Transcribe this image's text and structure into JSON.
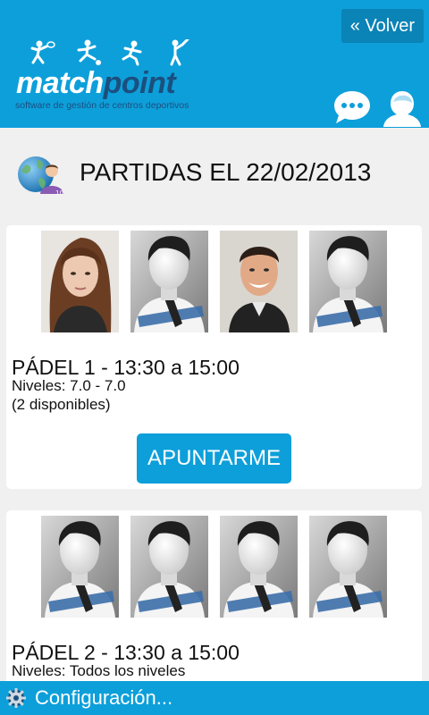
{
  "header": {
    "back_label": "« Volver",
    "logo_text_a": "match",
    "logo_text_b": "point",
    "logo_tagline": "software de gestión de centros deportivos",
    "icons": [
      "tennis-player-icon",
      "soccer-player-icon",
      "runner-icon",
      "golfer-icon",
      "chat-bubble-icon",
      "user-profile-icon"
    ]
  },
  "page": {
    "title": "PARTIDAS EL 22/02/2013",
    "title_icon": "globe-user-icon"
  },
  "matches": [
    {
      "title": "PÁDEL 1 - 13:30 a 15:00",
      "levels": "Niveles: 7.0 - 7.0",
      "availability": "(2 disponibles)",
      "join_label": "APUNTARME",
      "players": [
        "photo-woman",
        "placeholder",
        "photo-man",
        "placeholder"
      ]
    },
    {
      "title": "PÁDEL 2 - 13:30 a 15:00",
      "levels": "Niveles: Todos los niveles",
      "players": [
        "placeholder",
        "placeholder",
        "placeholder",
        "placeholder"
      ]
    }
  ],
  "footer": {
    "label": "Configuración..."
  },
  "colors": {
    "brand_blue": "#0d9fda",
    "back_button": "#0a83b6",
    "logo_dark": "#1b4f7e",
    "background": "#f0f0f0"
  }
}
